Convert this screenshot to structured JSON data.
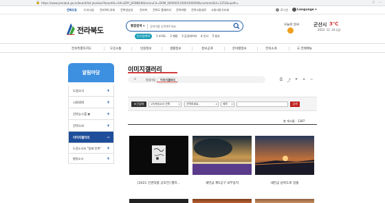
{
  "browser": {
    "url": "https://www.jeonbuk.go.kr/board/list.jeonbuk?boardId=GALLERY_JEONBUK&menuCd=DOM_000000110001000000&contentsSid=1253&cpath=",
    "lock_icon": "lock-icon"
  },
  "topnav": {
    "items": [
      "전북도청",
      "도지사실",
      "전라북도의회",
      "전북영상방",
      "전자북",
      "전북도 홈페이지",
      "전북여행",
      "전북소통대로",
      "고향사랑기부제"
    ],
    "login": "로그인",
    "language": "Language"
  },
  "logo": {
    "text": "전라북도"
  },
  "search": {
    "scope": "통합검색",
    "placeholder": "검색어를 입력해주세요."
  },
  "popular": {
    "label": "인기검색어",
    "keywords": [
      "1 조직도",
      "2 채용",
      "3 공공데이터",
      "4 인사",
      "5 청사"
    ]
  },
  "weather": {
    "today": "오늘의 날씨",
    "city": "군산시",
    "temp": "3℃",
    "date": "2023. 11. 24.(금)"
  },
  "gnb": {
    "items": [
      "전북특별자치도",
      "도민소통",
      "민원정보",
      "생활정보",
      "정보공개",
      "분야별정보",
      "전북소개"
    ],
    "all_menu": "전체메뉴"
  },
  "lnb": {
    "title": "알림마당",
    "items": [
      {
        "label": "도정소식",
        "plus": "+"
      },
      {
        "label": "시회외워",
        "plus": "+"
      },
      {
        "label": "전북뉴스룸 ⧉",
        "plus": "+"
      },
      {
        "label": "전북도보",
        "plus": "+"
      },
      {
        "label": "이미지갤러리",
        "plus": "−"
      }
    ],
    "subs": [
      {
        "label": "도정소식지 \"함께 전북\"",
        "plus": "+"
      },
      {
        "label": "행정소식",
        "plus": "+"
      }
    ]
  },
  "page": {
    "title": "이미지갤러리",
    "breadcrumb": [
      "홈",
      "알림마당",
      "이미지갤러리"
    ]
  },
  "searchbar": {
    "label": "조건검색",
    "select1": "1차카테고리 선택",
    "select2": "선택하세요.",
    "select3": "제목",
    "button": "검색"
  },
  "total": "총 게시물 : 1387",
  "gallery": [
    {
      "caption": "[2021 인권작품 공모전] 캘리..."
    },
    {
      "caption": "새만금 제5공구 내부용지"
    },
    {
      "caption": "새만금 남북도로 일출"
    }
  ],
  "colors": {
    "brand_blue": "#1e5aa8",
    "accent_red": "#d23a3a",
    "lnb_blue": "#3d8fe0"
  }
}
